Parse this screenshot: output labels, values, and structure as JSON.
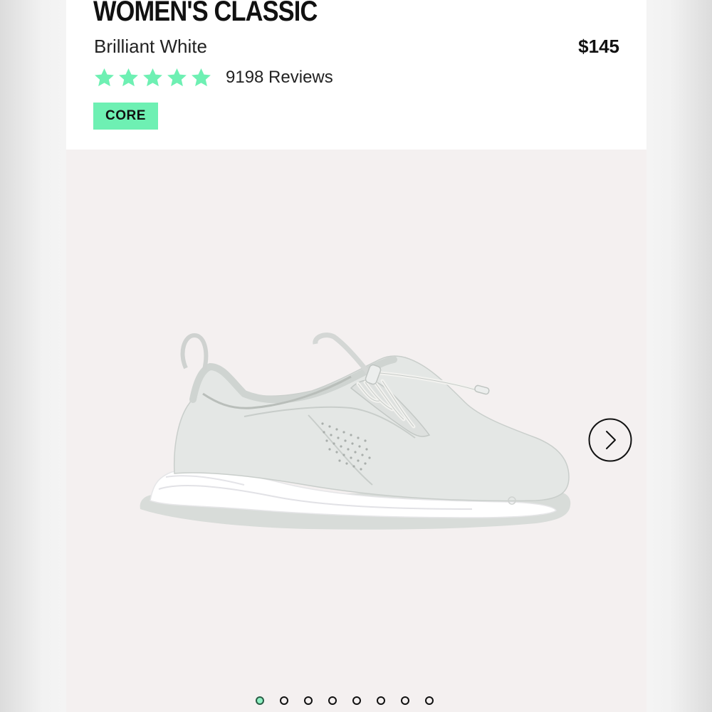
{
  "product": {
    "title": "WOMEN'S CLASSIC",
    "color_name": "Brilliant White",
    "price": "$145",
    "rating": {
      "stars": 5,
      "max_stars": 5,
      "reviews_label": "9198 Reviews"
    },
    "badge": "CORE"
  },
  "gallery": {
    "image_icon": "white-sneaker-image",
    "next_icon": "chevron-right-icon",
    "image_count": 8,
    "active_index": 0
  },
  "colors": {
    "accent": "#6ef0b3",
    "star": "#6ef0b3",
    "background": "#f4f0f0",
    "header": "#ffffff"
  }
}
